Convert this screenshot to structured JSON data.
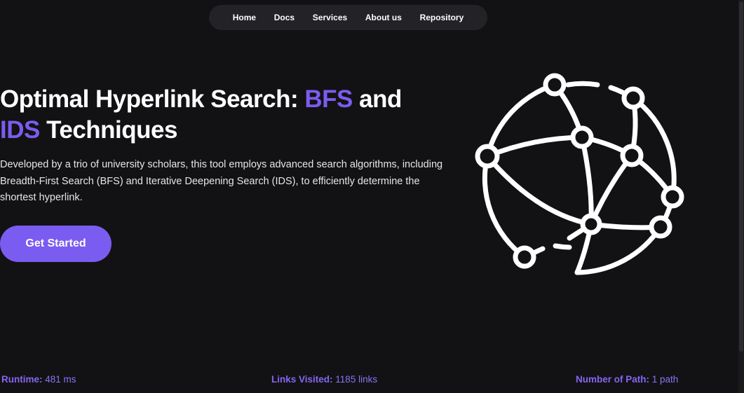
{
  "nav": {
    "items": [
      {
        "label": "Home"
      },
      {
        "label": "Docs"
      },
      {
        "label": "Services"
      },
      {
        "label": "About us"
      },
      {
        "label": "Repository"
      }
    ]
  },
  "hero": {
    "title_part1": "Optimal Hyperlink Search: ",
    "title_highlight1": "BFS",
    "title_part2": " and ",
    "title_highlight2": "IDS",
    "title_part3": " Techniques",
    "description": "Developed by a trio of university scholars, this tool employs advanced search algorithms, including Breadth-First Search (BFS) and Iterative Deepening Search (IDS), to efficiently determine the shortest hyperlink.",
    "cta_label": "Get Started"
  },
  "illustration": {
    "icon": "network-globe-icon"
  },
  "stats": {
    "runtime": {
      "label": "Runtime:",
      "value": "481 ms"
    },
    "links_visited": {
      "label": "Links Visited:",
      "value": "1185 links"
    },
    "paths": {
      "label": "Number of Path:",
      "value": "1 path"
    }
  },
  "colors": {
    "background": "#121214",
    "nav_background": "#232327",
    "accent": "#7b5cf0",
    "text": "#ffffff"
  }
}
